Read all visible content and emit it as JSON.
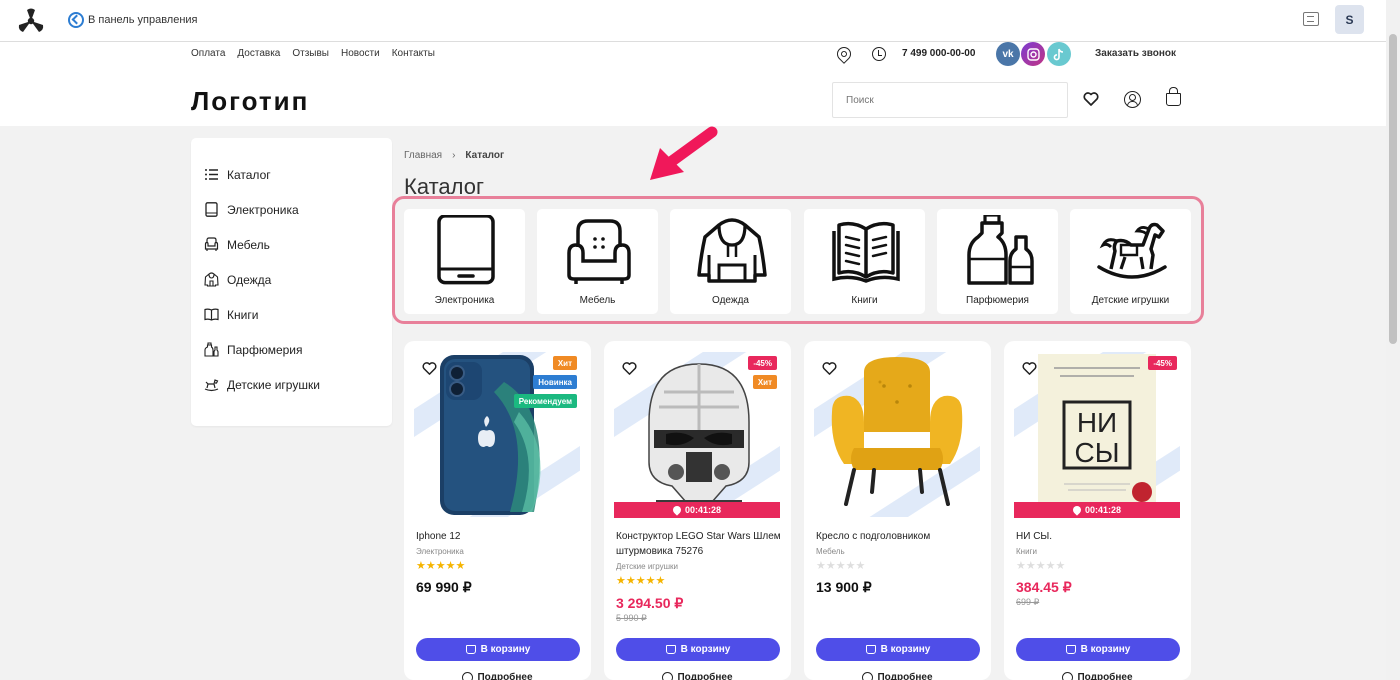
{
  "admin_bar": {
    "back_label": "В панель управления",
    "avatar_letter": "S"
  },
  "header": {
    "nav": [
      "Оплата",
      "Доставка",
      "Отзывы",
      "Новости",
      "Контакты"
    ],
    "phone": "7 499 000-00-00",
    "social": [
      "vk-icon",
      "instagram-icon",
      "tiktok-icon"
    ],
    "callback": "Заказать звонок",
    "logo": "Логотип",
    "search_placeholder": "Поиск"
  },
  "sidebar": {
    "items": [
      {
        "label": "Каталог",
        "icon": "list-icon"
      },
      {
        "label": "Электроника",
        "icon": "tablet-icon"
      },
      {
        "label": "Мебель",
        "icon": "armchair-icon"
      },
      {
        "label": "Одежда",
        "icon": "hoodie-icon"
      },
      {
        "label": "Книги",
        "icon": "book-icon"
      },
      {
        "label": "Парфюмерия",
        "icon": "perfume-icon"
      },
      {
        "label": "Детские игрушки",
        "icon": "rocking-horse-icon"
      }
    ]
  },
  "breadcrumb": {
    "home": "Главная",
    "separator": "›",
    "current": "Каталог"
  },
  "page_title": "Каталог",
  "categories": [
    {
      "label": "Электроника",
      "icon": "tablet-icon"
    },
    {
      "label": "Мебель",
      "icon": "armchair-icon"
    },
    {
      "label": "Одежда",
      "icon": "hoodie-icon"
    },
    {
      "label": "Книги",
      "icon": "book-icon"
    },
    {
      "label": "Парфюмерия",
      "icon": "perfume-icon"
    },
    {
      "label": "Детские игрушки",
      "icon": "rocking-horse-icon"
    }
  ],
  "products": [
    {
      "name": "Iphone 12",
      "category": "Электроника",
      "rating": 5,
      "price": "69 990 ₽",
      "old_price": "",
      "badges": [
        {
          "text": "Хит",
          "color": "#f08a24"
        },
        {
          "text": "Новинка",
          "color": "#2d7dd2"
        },
        {
          "text": "Рекомендуем",
          "color": "#1bb980"
        }
      ],
      "timer": ""
    },
    {
      "name": "Конструктор LEGO Star Wars Шлем штурмовика 75276",
      "category": "Детские игрушки",
      "rating": 5,
      "price": "3 294.50 ₽",
      "old_price": "5 990 ₽",
      "badges": [
        {
          "text": "-45%",
          "color": "#e8285c"
        },
        {
          "text": "Хит",
          "color": "#f08a24"
        }
      ],
      "timer": "00:41:28"
    },
    {
      "name": "Кресло с подголовником",
      "category": "Мебель",
      "rating": 0,
      "price": "13 900 ₽",
      "old_price": "",
      "badges": [],
      "timer": ""
    },
    {
      "name": "НИ СЫ.",
      "category": "Книги",
      "rating": 0,
      "price": "384.45 ₽",
      "old_price": "699 ₽",
      "badges": [
        {
          "text": "-45%",
          "color": "#e8285c"
        }
      ],
      "timer": "00:41:28"
    }
  ],
  "buttons": {
    "cart": "В корзину",
    "more": "Подробнее"
  },
  "book_cover_text": "НИ\nСЫ",
  "colors": {
    "accent": "#4f4ee8",
    "sale": "#e8285c",
    "highlight_border": "#e8809a",
    "arrow": "#f0185a",
    "star": "#f5b400"
  }
}
